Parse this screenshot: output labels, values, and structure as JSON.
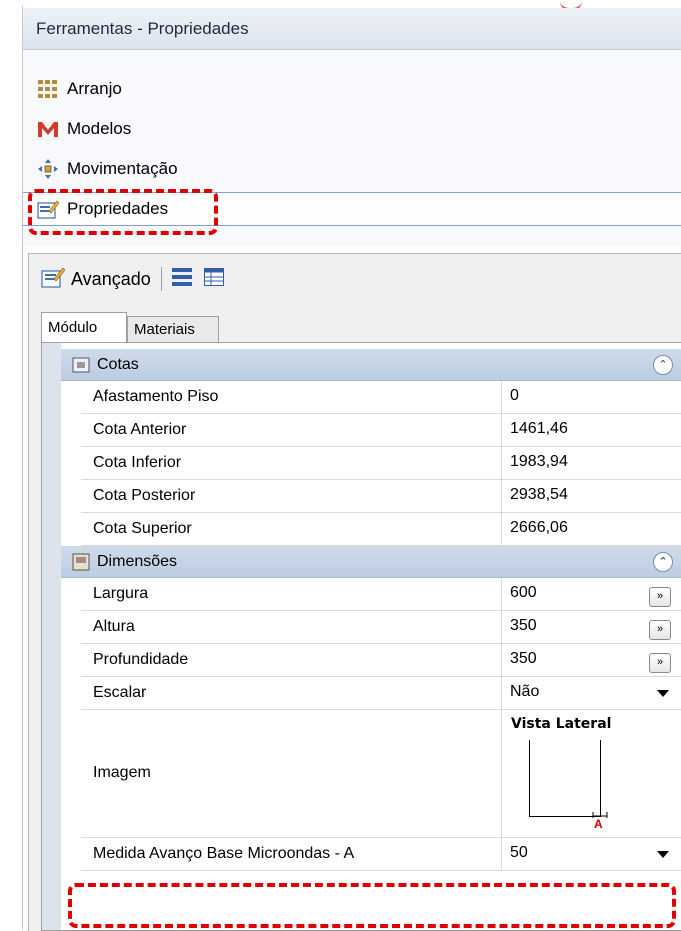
{
  "window": {
    "title": "Ferramentas - Propriedades"
  },
  "nav": {
    "items": [
      {
        "label": "Arranjo",
        "icon": "grid-icon"
      },
      {
        "label": "Modelos",
        "icon": "models-m-icon"
      },
      {
        "label": "Movimentação",
        "icon": "move-arrows-icon"
      },
      {
        "label": "Propriedades",
        "icon": "properties-icon",
        "selected": true
      }
    ]
  },
  "toolbar": {
    "label": "Avançado",
    "icons": [
      "properties-icon",
      "categorized-view-icon",
      "alphabetical-view-icon"
    ]
  },
  "tabs": [
    {
      "label": "Módulo",
      "active": true
    },
    {
      "label": "Materiais",
      "active": false
    }
  ],
  "categories": {
    "cotas": {
      "label": "Cotas",
      "rows": [
        {
          "name": "Afastamento Piso",
          "value": "0"
        },
        {
          "name": "Cota Anterior",
          "value": "1461,46"
        },
        {
          "name": "Cota Inferior",
          "value": "1983,94"
        },
        {
          "name": "Cota Posterior",
          "value": "2938,54"
        },
        {
          "name": "Cota Superior",
          "value": "2666,06"
        }
      ]
    },
    "dimensoes": {
      "label": "Dimensões",
      "rows": [
        {
          "name": "Largura",
          "value": "600"
        },
        {
          "name": "Altura",
          "value": "350"
        },
        {
          "name": "Profundidade",
          "value": "350"
        },
        {
          "name": "Escalar",
          "value": "Não"
        },
        {
          "name": "Imagem",
          "value": ""
        },
        {
          "name": "Medida Avanço Base Microondas - A",
          "value": "50"
        }
      ],
      "image_title": "Vista Lateral",
      "image_marker": "A",
      "ellipsis_label": "»"
    }
  },
  "colors": {
    "highlight": "#e00000",
    "category_band": "#c6d4e7",
    "selection_line": "#7da2ce"
  }
}
